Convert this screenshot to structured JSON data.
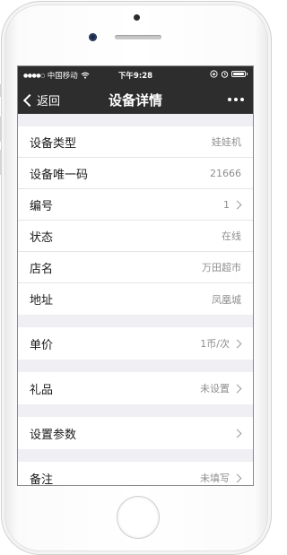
{
  "status_bar": {
    "signal_dots": "●●●●○",
    "carrier": "中国移动",
    "time": "下午9:28"
  },
  "nav": {
    "back_label": "返回",
    "title": "设备详情"
  },
  "info_group": [
    {
      "label": "设备类型",
      "value": "娃娃机",
      "chevron": false
    },
    {
      "label": "设备唯一码",
      "value": "21666",
      "chevron": false
    },
    {
      "label": "编号",
      "value": "1",
      "chevron": true
    },
    {
      "label": "状态",
      "value": "在线",
      "chevron": false
    },
    {
      "label": "店名",
      "value": "万田超市",
      "chevron": false
    },
    {
      "label": "地址",
      "value": "凤凰城",
      "chevron": false
    }
  ],
  "price": {
    "label": "单价",
    "value": "1币/次",
    "chevron": true
  },
  "gift": {
    "label": "礼品",
    "value": "未设置",
    "chevron": true
  },
  "settings": {
    "label": "设置参数",
    "value": "",
    "chevron": true
  },
  "remark": {
    "label": "备注",
    "value": "未填写",
    "chevron": true
  },
  "colors": {
    "bar_bg": "#2d2d2d",
    "page_bg": "#efeff4",
    "cell_bg": "#ffffff",
    "value_text": "#8e8e8e"
  },
  "icons": [
    "wifi-icon",
    "orientation-lock-icon",
    "alarm-icon",
    "battery-icon",
    "back-chevron-icon",
    "more-dots-icon",
    "chevron-right-icon"
  ]
}
